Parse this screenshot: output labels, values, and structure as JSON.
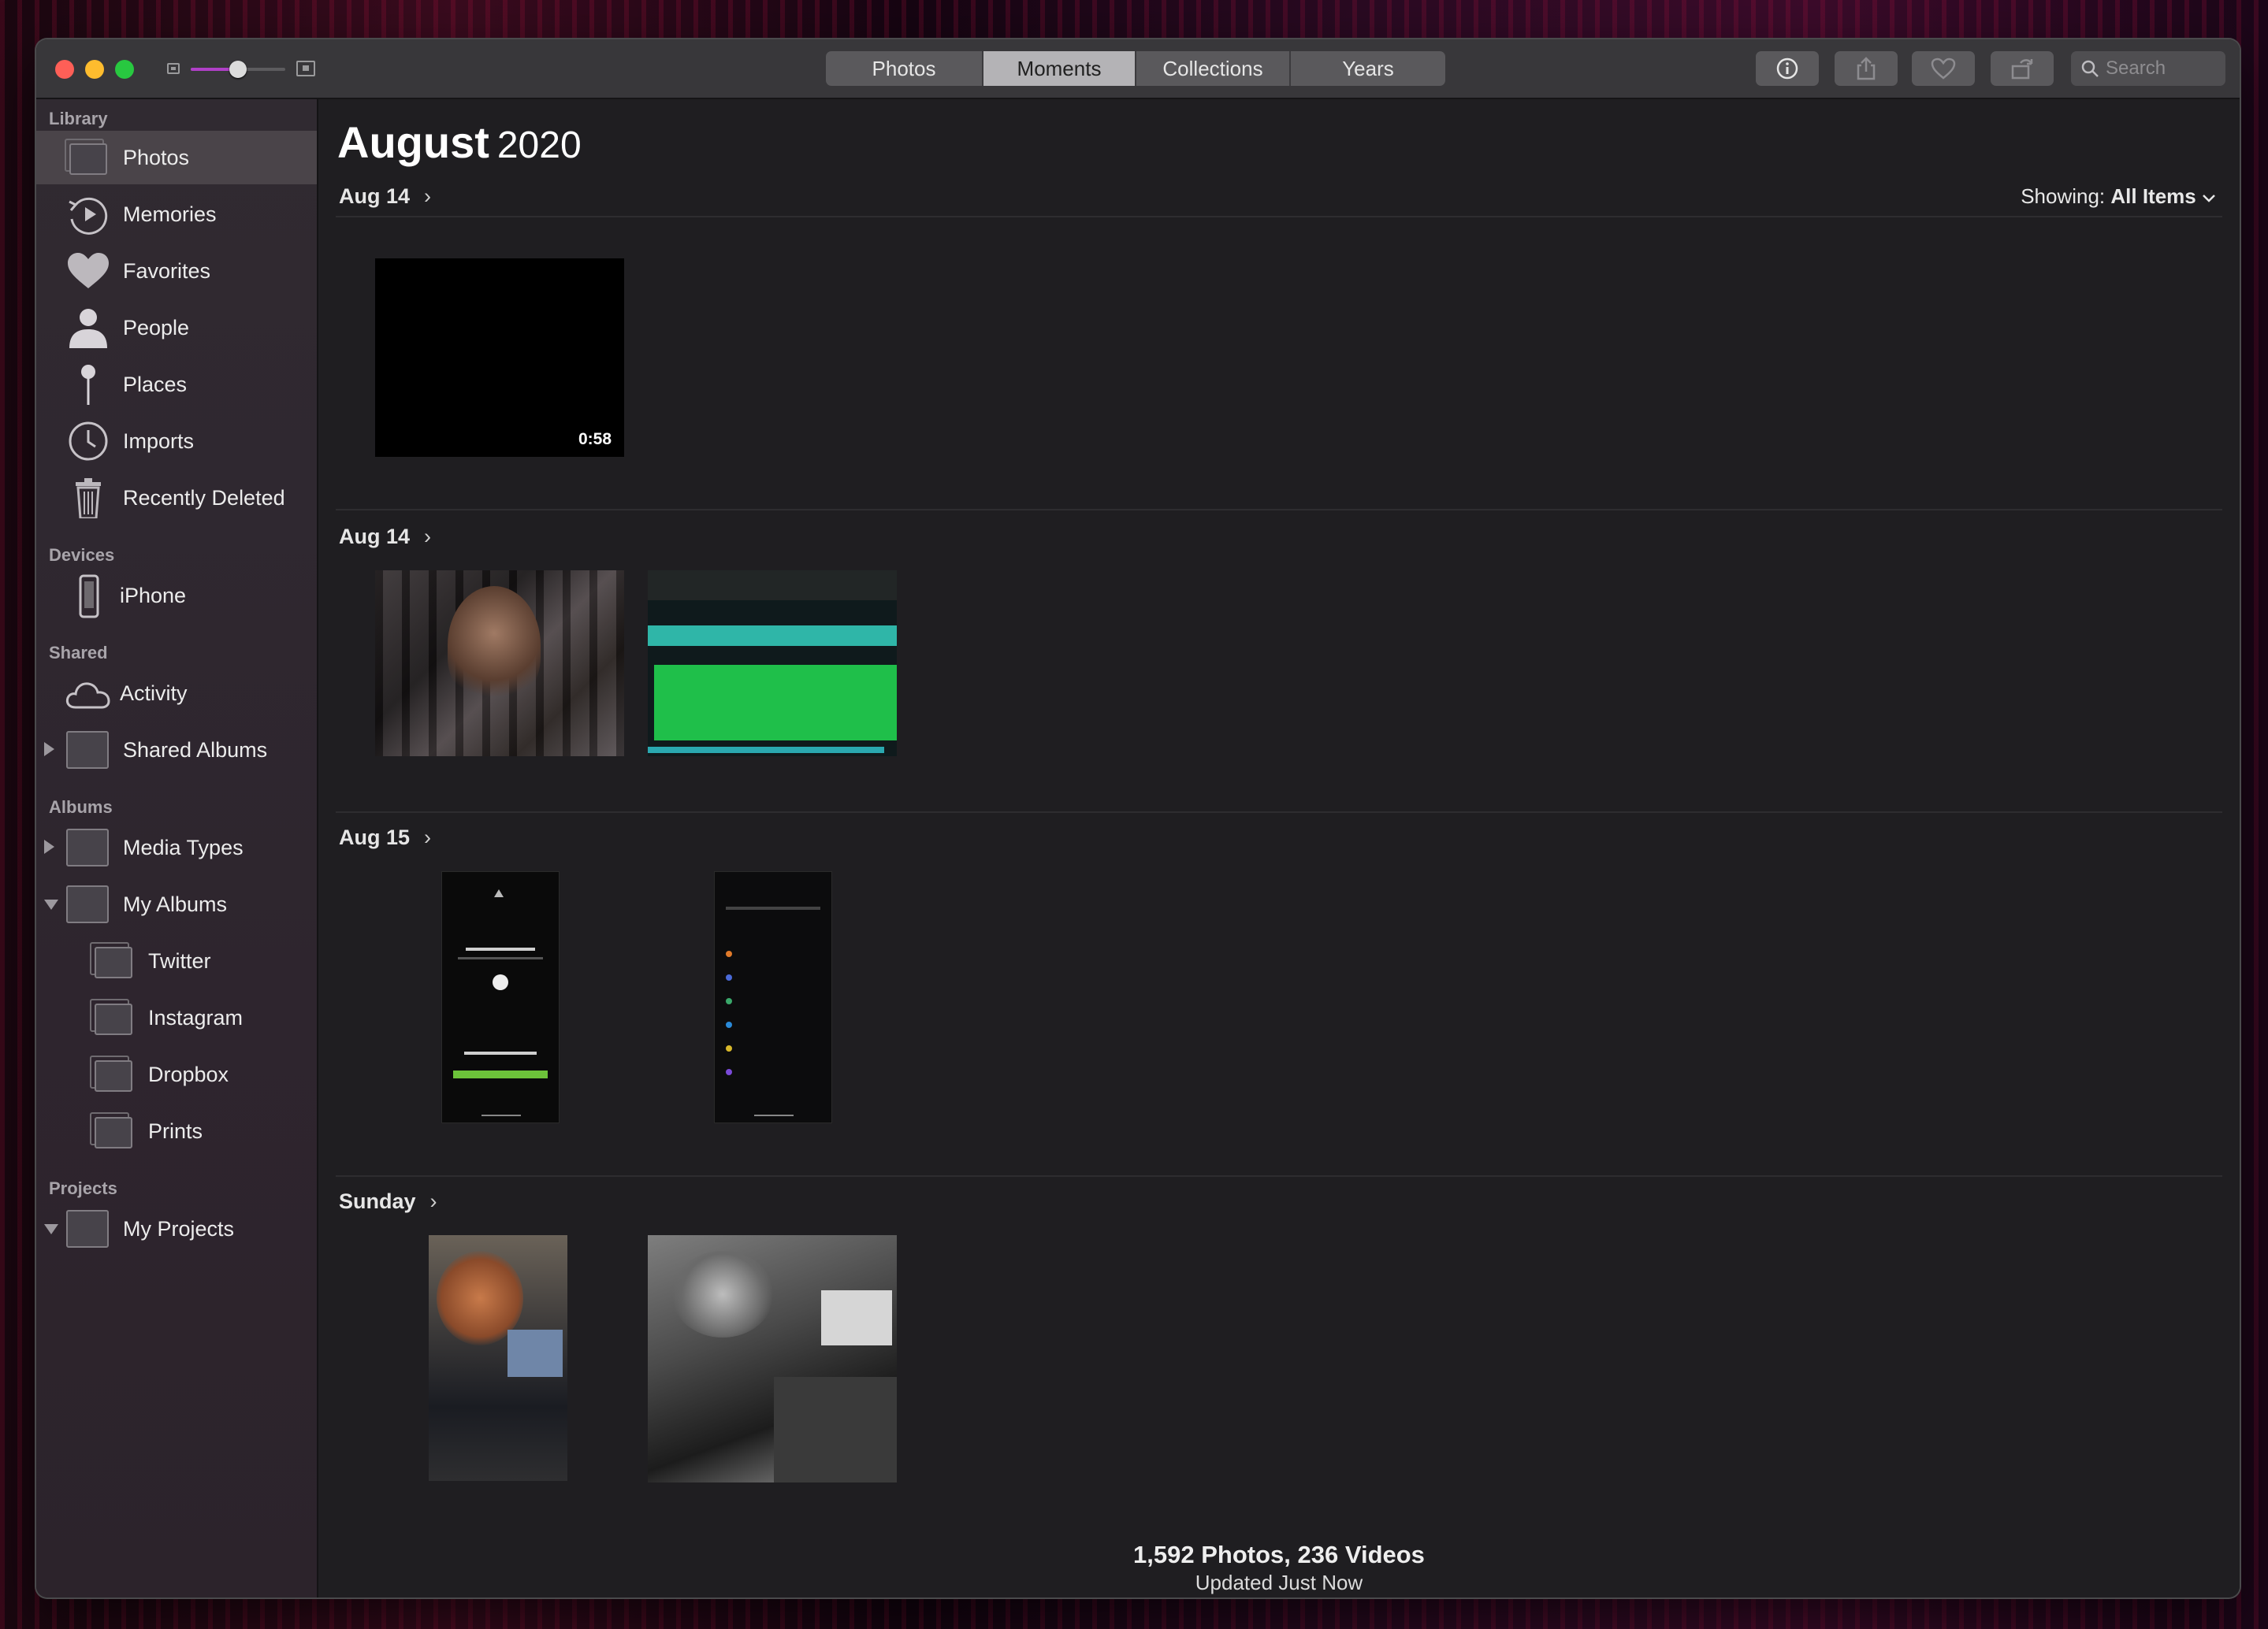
{
  "window": {
    "view_tabs": [
      {
        "label": "Photos",
        "active": false
      },
      {
        "label": "Moments",
        "active": true
      },
      {
        "label": "Collections",
        "active": false
      },
      {
        "label": "Years",
        "active": false
      }
    ],
    "zoom_level": 0.5,
    "search_placeholder": "Search",
    "toolbar_icons": [
      "info-icon",
      "share-icon",
      "heart-icon",
      "rotate-icon"
    ]
  },
  "sidebar": {
    "library_header": "Library",
    "library_items": [
      {
        "label": "Photos",
        "icon": "photos-icon",
        "selected": true
      },
      {
        "label": "Memories",
        "icon": "memories-icon"
      },
      {
        "label": "Favorites",
        "icon": "heart-icon"
      },
      {
        "label": "People",
        "icon": "person-icon"
      },
      {
        "label": "Places",
        "icon": "pin-icon"
      },
      {
        "label": "Imports",
        "icon": "clock-icon"
      },
      {
        "label": "Recently Deleted",
        "icon": "trash-icon"
      }
    ],
    "devices_header": "Devices",
    "device_items": [
      {
        "label": "iPhone",
        "icon": "iphone-icon"
      }
    ],
    "shared_header": "Shared",
    "shared_items": [
      {
        "label": "Activity",
        "icon": "cloud-icon"
      },
      {
        "label": "Shared Albums",
        "icon": "album-icon",
        "disclosure": "collapsed"
      }
    ],
    "albums_header": "Albums",
    "album_items": [
      {
        "label": "Media Types",
        "disclosure": "collapsed"
      },
      {
        "label": "My Albums",
        "disclosure": "expanded"
      },
      {
        "label": "Twitter"
      },
      {
        "label": "Instagram"
      },
      {
        "label": "Dropbox"
      },
      {
        "label": "Prints"
      }
    ],
    "projects_header": "Projects",
    "project_items": [
      {
        "label": "My Projects",
        "disclosure": "expanded"
      }
    ]
  },
  "main": {
    "title_month": "August",
    "title_year": "2020",
    "showing_label": "Showing:",
    "showing_value": "All Items",
    "moments": [
      {
        "label": "Aug 14",
        "items": [
          {
            "kind": "video",
            "duration": "0:58"
          }
        ]
      },
      {
        "label": "Aug 14",
        "items": [
          {
            "kind": "photo"
          },
          {
            "kind": "photo"
          }
        ]
      },
      {
        "label": "Aug 15",
        "items": [
          {
            "kind": "screenshot"
          },
          {
            "kind": "screenshot"
          }
        ]
      },
      {
        "label": "Sunday",
        "items": [
          {
            "kind": "photo"
          },
          {
            "kind": "photo"
          }
        ]
      }
    ],
    "footer_count": "1,592 Photos, 236 Videos",
    "footer_updated": "Updated Just Now"
  },
  "colors": {
    "accent": "#b040c8",
    "close": "#fe5f57",
    "minimize": "#febc2e",
    "maximize": "#28c840",
    "sidebar_bg": "#302a31",
    "main_bg": "#1f1e21"
  }
}
